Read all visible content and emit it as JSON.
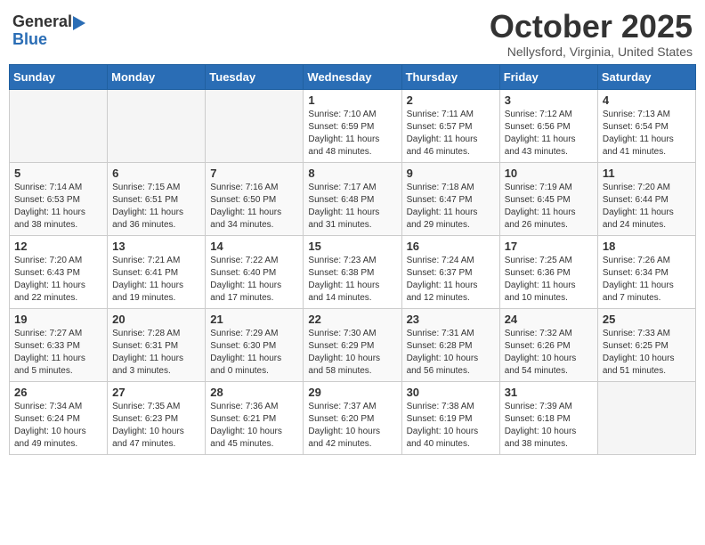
{
  "header": {
    "logo_general": "General",
    "logo_blue": "Blue",
    "month_title": "October 2025",
    "location": "Nellysford, Virginia, United States"
  },
  "days_of_week": [
    "Sunday",
    "Monday",
    "Tuesday",
    "Wednesday",
    "Thursday",
    "Friday",
    "Saturday"
  ],
  "weeks": [
    [
      {
        "day": "",
        "info": ""
      },
      {
        "day": "",
        "info": ""
      },
      {
        "day": "",
        "info": ""
      },
      {
        "day": "1",
        "info": "Sunrise: 7:10 AM\nSunset: 6:59 PM\nDaylight: 11 hours and 48 minutes."
      },
      {
        "day": "2",
        "info": "Sunrise: 7:11 AM\nSunset: 6:57 PM\nDaylight: 11 hours and 46 minutes."
      },
      {
        "day": "3",
        "info": "Sunrise: 7:12 AM\nSunset: 6:56 PM\nDaylight: 11 hours and 43 minutes."
      },
      {
        "day": "4",
        "info": "Sunrise: 7:13 AM\nSunset: 6:54 PM\nDaylight: 11 hours and 41 minutes."
      }
    ],
    [
      {
        "day": "5",
        "info": "Sunrise: 7:14 AM\nSunset: 6:53 PM\nDaylight: 11 hours and 38 minutes."
      },
      {
        "day": "6",
        "info": "Sunrise: 7:15 AM\nSunset: 6:51 PM\nDaylight: 11 hours and 36 minutes."
      },
      {
        "day": "7",
        "info": "Sunrise: 7:16 AM\nSunset: 6:50 PM\nDaylight: 11 hours and 34 minutes."
      },
      {
        "day": "8",
        "info": "Sunrise: 7:17 AM\nSunset: 6:48 PM\nDaylight: 11 hours and 31 minutes."
      },
      {
        "day": "9",
        "info": "Sunrise: 7:18 AM\nSunset: 6:47 PM\nDaylight: 11 hours and 29 minutes."
      },
      {
        "day": "10",
        "info": "Sunrise: 7:19 AM\nSunset: 6:45 PM\nDaylight: 11 hours and 26 minutes."
      },
      {
        "day": "11",
        "info": "Sunrise: 7:20 AM\nSunset: 6:44 PM\nDaylight: 11 hours and 24 minutes."
      }
    ],
    [
      {
        "day": "12",
        "info": "Sunrise: 7:20 AM\nSunset: 6:43 PM\nDaylight: 11 hours and 22 minutes."
      },
      {
        "day": "13",
        "info": "Sunrise: 7:21 AM\nSunset: 6:41 PM\nDaylight: 11 hours and 19 minutes."
      },
      {
        "day": "14",
        "info": "Sunrise: 7:22 AM\nSunset: 6:40 PM\nDaylight: 11 hours and 17 minutes."
      },
      {
        "day": "15",
        "info": "Sunrise: 7:23 AM\nSunset: 6:38 PM\nDaylight: 11 hours and 14 minutes."
      },
      {
        "day": "16",
        "info": "Sunrise: 7:24 AM\nSunset: 6:37 PM\nDaylight: 11 hours and 12 minutes."
      },
      {
        "day": "17",
        "info": "Sunrise: 7:25 AM\nSunset: 6:36 PM\nDaylight: 11 hours and 10 minutes."
      },
      {
        "day": "18",
        "info": "Sunrise: 7:26 AM\nSunset: 6:34 PM\nDaylight: 11 hours and 7 minutes."
      }
    ],
    [
      {
        "day": "19",
        "info": "Sunrise: 7:27 AM\nSunset: 6:33 PM\nDaylight: 11 hours and 5 minutes."
      },
      {
        "day": "20",
        "info": "Sunrise: 7:28 AM\nSunset: 6:31 PM\nDaylight: 11 hours and 3 minutes."
      },
      {
        "day": "21",
        "info": "Sunrise: 7:29 AM\nSunset: 6:30 PM\nDaylight: 11 hours and 0 minutes."
      },
      {
        "day": "22",
        "info": "Sunrise: 7:30 AM\nSunset: 6:29 PM\nDaylight: 10 hours and 58 minutes."
      },
      {
        "day": "23",
        "info": "Sunrise: 7:31 AM\nSunset: 6:28 PM\nDaylight: 10 hours and 56 minutes."
      },
      {
        "day": "24",
        "info": "Sunrise: 7:32 AM\nSunset: 6:26 PM\nDaylight: 10 hours and 54 minutes."
      },
      {
        "day": "25",
        "info": "Sunrise: 7:33 AM\nSunset: 6:25 PM\nDaylight: 10 hours and 51 minutes."
      }
    ],
    [
      {
        "day": "26",
        "info": "Sunrise: 7:34 AM\nSunset: 6:24 PM\nDaylight: 10 hours and 49 minutes."
      },
      {
        "day": "27",
        "info": "Sunrise: 7:35 AM\nSunset: 6:23 PM\nDaylight: 10 hours and 47 minutes."
      },
      {
        "day": "28",
        "info": "Sunrise: 7:36 AM\nSunset: 6:21 PM\nDaylight: 10 hours and 45 minutes."
      },
      {
        "day": "29",
        "info": "Sunrise: 7:37 AM\nSunset: 6:20 PM\nDaylight: 10 hours and 42 minutes."
      },
      {
        "day": "30",
        "info": "Sunrise: 7:38 AM\nSunset: 6:19 PM\nDaylight: 10 hours and 40 minutes."
      },
      {
        "day": "31",
        "info": "Sunrise: 7:39 AM\nSunset: 6:18 PM\nDaylight: 10 hours and 38 minutes."
      },
      {
        "day": "",
        "info": ""
      }
    ]
  ]
}
